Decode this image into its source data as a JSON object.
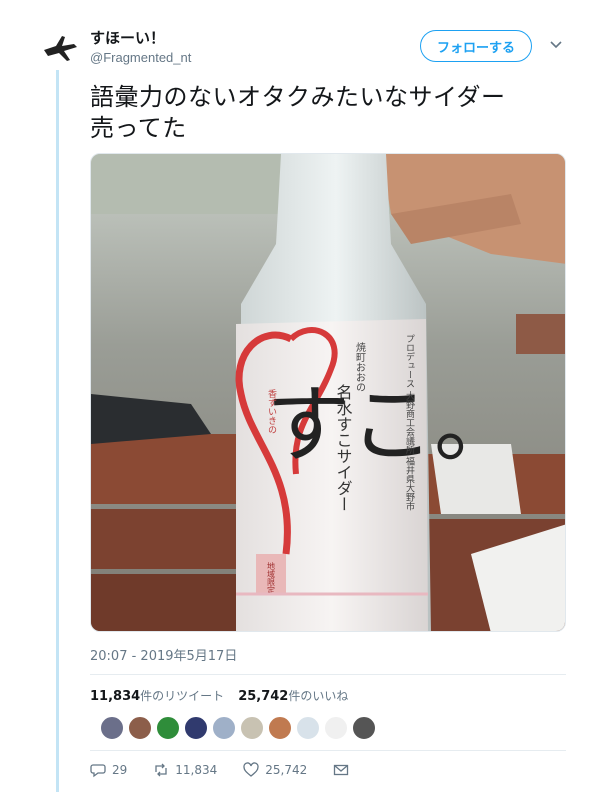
{
  "user": {
    "display_name": "すほーい！",
    "handle": "@Fragmented_nt"
  },
  "follow_button": "フォローする",
  "tweet": {
    "text_line1": "語彙力のないオタクみたいなサイダー",
    "text_line2": "売ってた"
  },
  "photo": {
    "label_small": "焼町おおの",
    "label_title": "名水すこサイダー",
    "label_big": "すこ。",
    "label_heart_text": "香ずいきの",
    "label_stamp": "地域限定",
    "label_side_text": "プロデュース 大野商工会議所 福井県大野市"
  },
  "timestamp": "20:07 - 2019年5月17日",
  "stats": {
    "retweets_count": "11,834",
    "retweets_label": "件のリツイート",
    "likes_count": "25,742",
    "likes_label": "件のいいね"
  },
  "actions": {
    "reply_count": "29",
    "retweet_count": "11,834",
    "like_count": "25,742"
  },
  "colors": {
    "accent": "#1da1f2",
    "thread_line": "#c3e4f5",
    "muted": "#657786"
  }
}
